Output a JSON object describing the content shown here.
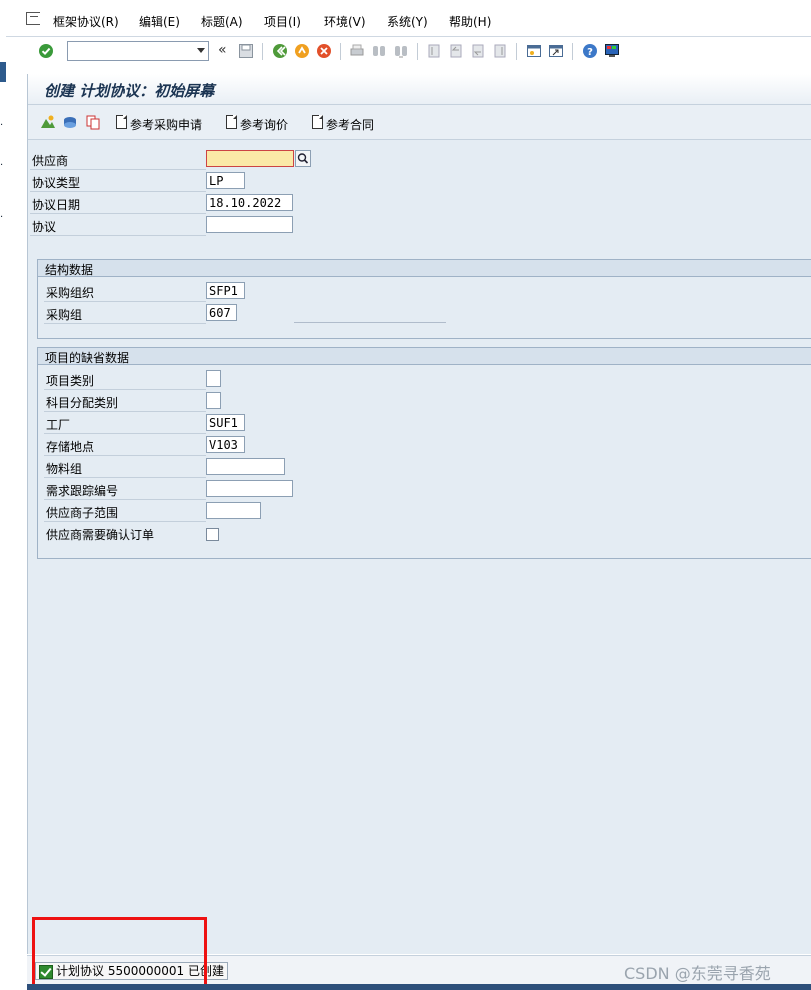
{
  "menu": {
    "items": [
      "框架协议(R)",
      "编辑(E)",
      "标题(A)",
      "项目(I)",
      "环境(V)",
      "系统(Y)",
      "帮助(H)"
    ]
  },
  "toolbar": {
    "command_value": "",
    "back_symbol": "«"
  },
  "screen": {
    "title": "创建 计划协议：初始屏幕"
  },
  "app_toolbar": {
    "ref_pr": "参考采购申请",
    "ref_rfq": "参考询价",
    "ref_contract": "参考合同"
  },
  "header_fields": {
    "vendor_label": "供应商",
    "vendor_value": "",
    "agreement_type_label": "协议类型",
    "agreement_type_value": "LP",
    "agreement_date_label": "协议日期",
    "agreement_date_value": "18.10.2022",
    "agreement_label": "协议",
    "agreement_value": ""
  },
  "org_data": {
    "title": "结构数据",
    "purch_org_label": "采购组织",
    "purch_org_value": "SFP1",
    "purch_group_label": "采购组",
    "purch_group_value": "607"
  },
  "item_defaults": {
    "title": "项目的缺省数据",
    "item_category_label": "项目类别",
    "item_category_value": "",
    "acct_assign_label": "科目分配类别",
    "acct_assign_value": "",
    "plant_label": "工厂",
    "plant_value": "SUF1",
    "storage_loc_label": "存储地点",
    "storage_loc_value": "V103",
    "material_group_label": "物料组",
    "material_group_value": "",
    "req_tracking_label": "需求跟踪编号",
    "req_tracking_value": "",
    "vendor_subrange_label": "供应商子范围",
    "vendor_subrange_value": "",
    "ack_required_label": "供应商需要确认订单",
    "ack_required_checked": false
  },
  "status": {
    "message": "计划协议 5500000001 已创建"
  },
  "watermark": "CSDN @东莞寻香苑",
  "colors": {
    "highlight_border": "#ee1111",
    "required_field": "#fbe9a7",
    "content_bg": "#e4ecf3"
  }
}
